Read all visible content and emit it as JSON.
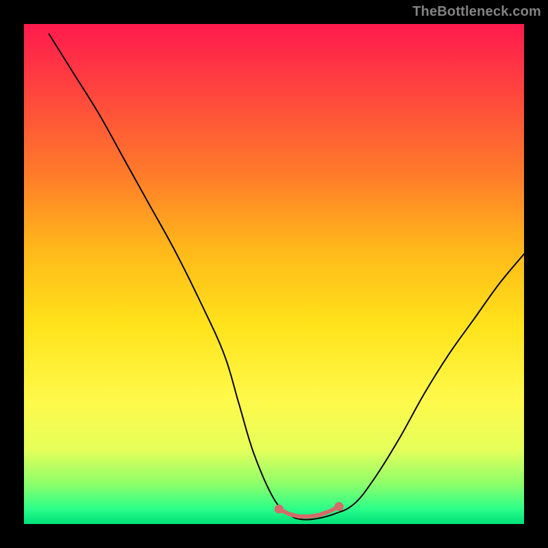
{
  "watermark": "TheBottleneck.com",
  "chart_data": {
    "type": "line",
    "title": "",
    "xlabel": "",
    "ylabel": "",
    "xlim": [
      0,
      100
    ],
    "ylim": [
      0,
      100
    ],
    "grid": false,
    "legend": false,
    "colors": {
      "background_gradient_top": "#ff1a4d",
      "background_gradient_bottom": "#00e07a",
      "curve": "#000000",
      "highlight_dots": "#d46a6a"
    },
    "series": [
      {
        "name": "bottleneck-curve",
        "x": [
          5,
          10,
          15,
          20,
          25,
          30,
          35,
          40,
          43,
          46,
          50,
          53,
          55,
          58,
          62,
          66,
          70,
          75,
          80,
          85,
          90,
          95,
          100
        ],
        "y": [
          98,
          90,
          82,
          73,
          64,
          55,
          45,
          34,
          24,
          14,
          5,
          2,
          1,
          1,
          2,
          4,
          9,
          17,
          26,
          34,
          41,
          48,
          54
        ]
      },
      {
        "name": "optimal-band",
        "x": [
          51,
          53,
          55,
          57,
          59,
          61,
          63
        ],
        "y": [
          3,
          2,
          1.5,
          1.5,
          1.8,
          2.5,
          3.5
        ]
      }
    ]
  }
}
